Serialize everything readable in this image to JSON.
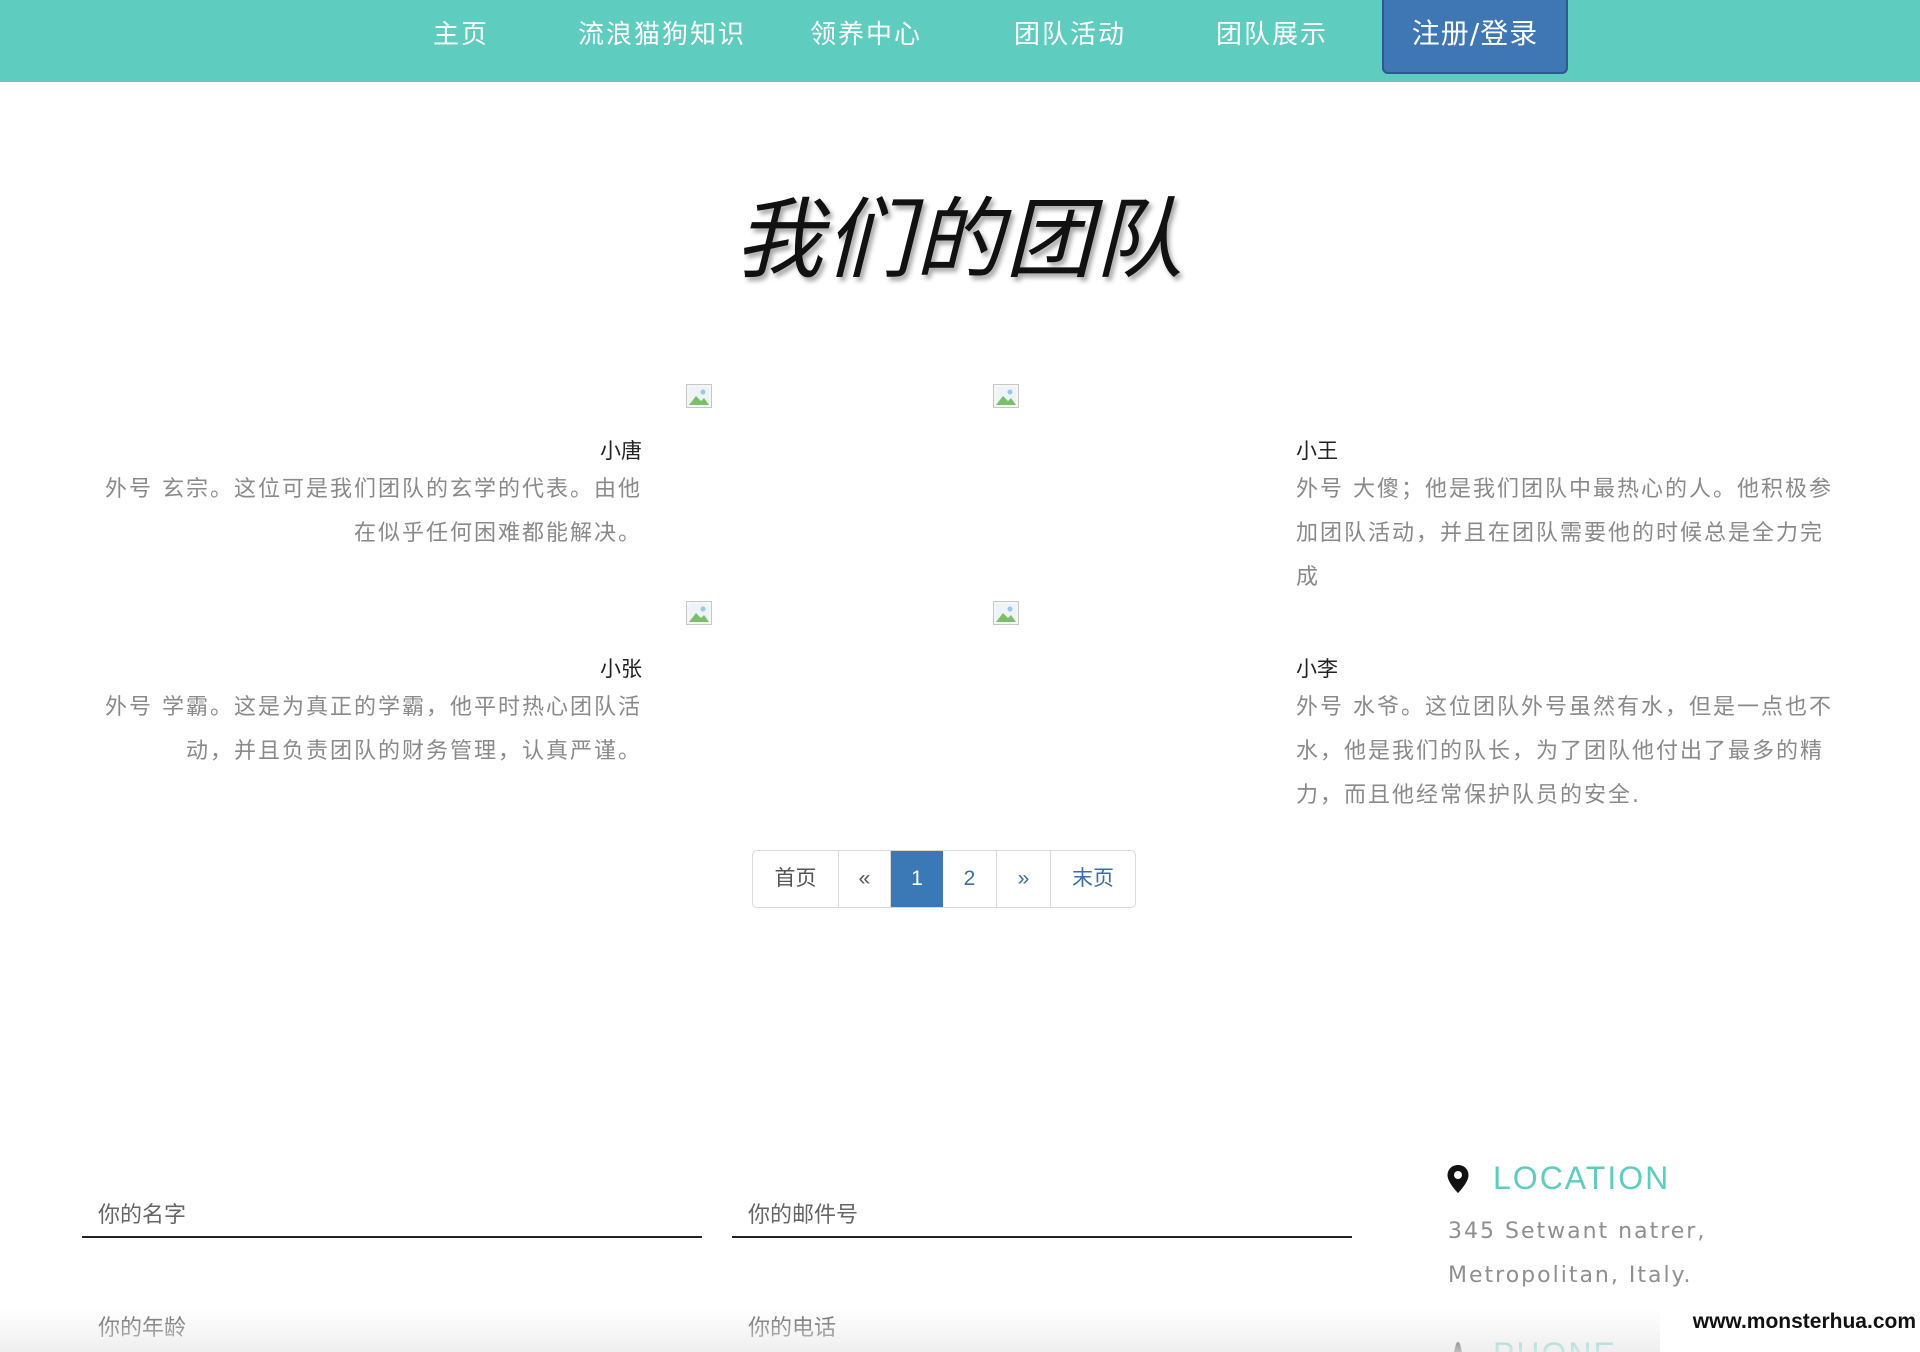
{
  "nav": {
    "items": [
      "主页",
      "流浪猫狗知识",
      "领养中心",
      "团队活动",
      "团队展示"
    ],
    "login": "注册/登录"
  },
  "title": "我们的团队",
  "members": [
    {
      "name": "小唐",
      "desc": "外号 玄宗。这位可是我们团队的玄学的代表。由他在似乎任何困难都能解决。"
    },
    {
      "name": "小王",
      "desc": "外号 大傻；他是我们团队中最热心的人。他积极参加团队活动，并且在团队需要他的时候总是全力完成"
    },
    {
      "name": "小张",
      "desc": "外号 学霸。这是为真正的学霸，他平时热心团队活动，并且负责团队的财务管理，认真严谨。"
    },
    {
      "name": "小李",
      "desc": "外号 水爷。这位团队外号虽然有水，但是一点也不水，他是我们的队长，为了团队他付出了最多的精力，而且他经常保护队员的安全."
    }
  ],
  "pagination": {
    "first": "首页",
    "prev": "«",
    "pages": [
      "1",
      "2"
    ],
    "current": "1",
    "next": "»",
    "last": "末页"
  },
  "form": {
    "name_placeholder": "你的名字",
    "email_placeholder": "你的邮件号",
    "age_placeholder": "你的年龄",
    "phone_placeholder": "你的电话"
  },
  "contact": {
    "location_title": "LOCATION",
    "address_line1": "345 Setwant natrer,",
    "address_line2": "Metropolitan, Italy.",
    "phone_title": "PHONE"
  },
  "watermark": "www.monsterhua.com",
  "colors": {
    "nav_bg": "#5ecdc0",
    "login_bg": "#3f77b5",
    "accent": "#5ecdc0",
    "pager_active": "#3a78b6"
  }
}
